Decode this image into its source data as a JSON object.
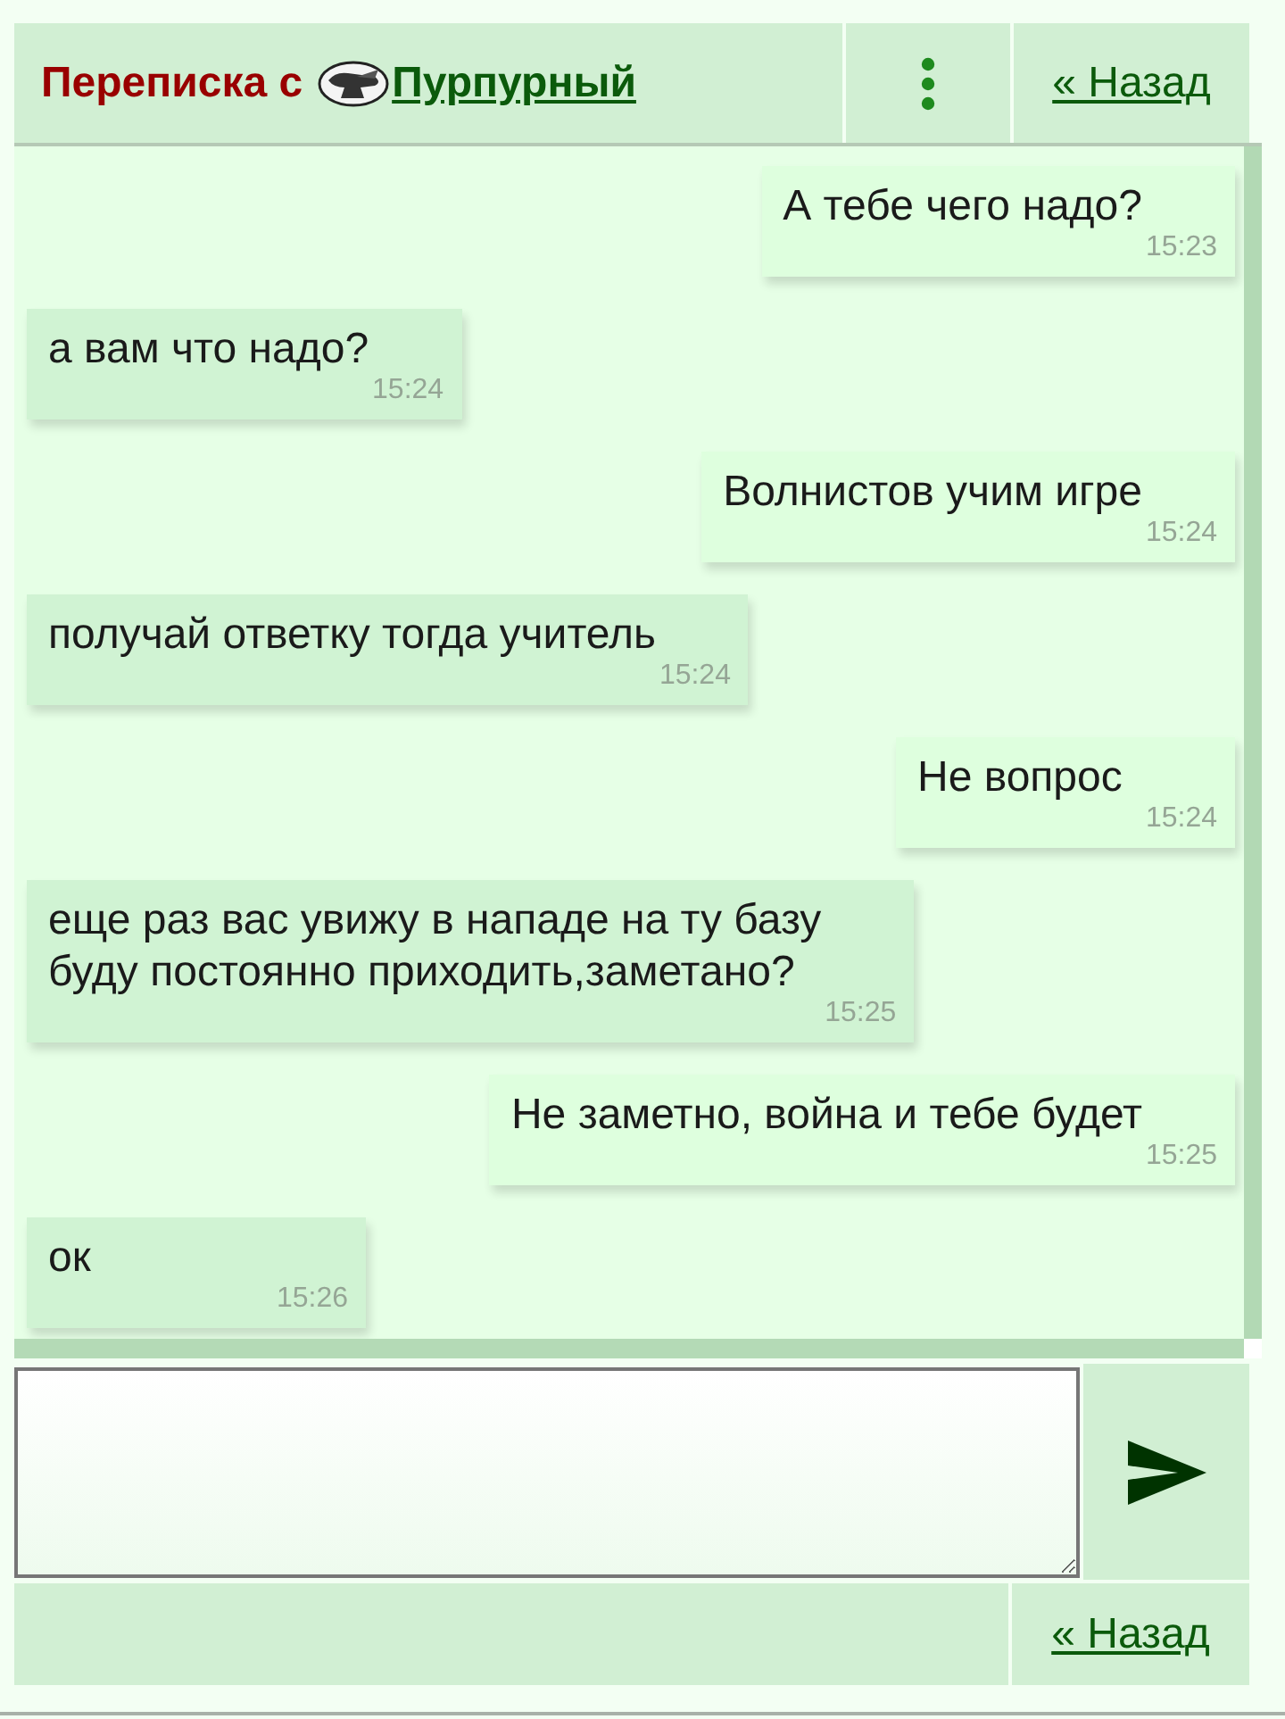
{
  "header": {
    "title_prefix": "Переписка с",
    "contact_name": "Пурпурный",
    "back_link": "« Назад"
  },
  "messages": [
    {
      "kind": "outgoing",
      "text": "А тебе чего надо?",
      "time": "15:23"
    },
    {
      "kind": "incoming",
      "text": "а вам что надо?",
      "time": "15:24"
    },
    {
      "kind": "outgoing",
      "text": "Волнистов учим игре",
      "time": "15:24"
    },
    {
      "kind": "incoming",
      "text": "получай ответку тогда учитель",
      "time": "15:24"
    },
    {
      "kind": "outgoing",
      "text": "Не вопрос",
      "time": "15:24"
    },
    {
      "kind": "incoming",
      "text": "еще раз вас увижу в нападе на ту базу\nбуду постоянно приходить,заметано?",
      "time": "15:25"
    },
    {
      "kind": "outgoing",
      "text": "Не заметно, война и тебе будет",
      "time": "15:25"
    },
    {
      "kind": "incoming",
      "text": "ок",
      "time": "15:26"
    }
  ],
  "footer": {
    "back_link": "« Назад"
  }
}
